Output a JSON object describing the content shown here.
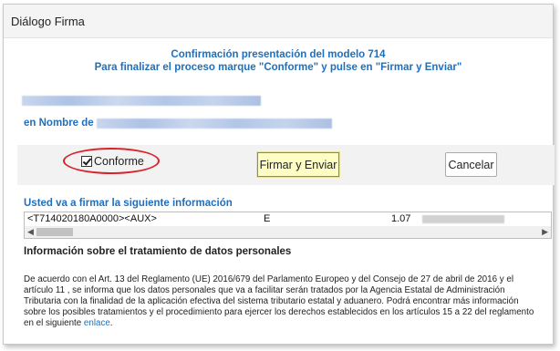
{
  "window": {
    "title": "Diálogo Firma"
  },
  "header": {
    "line1": "Confirmación presentación del modelo 714",
    "line2": "Para finalizar el proceso marque \"Conforme\" y pulse en \"Firmar y Enviar\""
  },
  "nombre": {
    "label": "en Nombre de"
  },
  "actions": {
    "conforme_label": "Conforme",
    "conforme_checked": true,
    "sign_button": "Firmar y Enviar",
    "cancel_button": "Cancelar"
  },
  "sign_info": {
    "heading": "Usted va a firmar la siguiente información",
    "row": {
      "code": "<T714020180A0000><AUX>",
      "flag": "E",
      "amount": "1.07"
    }
  },
  "privacy": {
    "heading": "Información sobre el tratamiento de datos personales",
    "text": "De acuerdo con el Art. 13 del Reglamento (UE) 2016/679 del Parlamento Europeo y del Consejo de 27 de abril de 2016 y el artículo 11 , se informa que los datos personales que va a facilitar serán tratados por la Agencia Estatal de Administración Tributaria con la finalidad de la aplicación efectiva del sistema tributario estatal y aduanero. Podrá encontrar más información sobre los posibles tratamientos y el procedimiento para ejercer los derechos establecidos en los artículos 15 a 22 del reglamento en el siguiente",
    "link": "enlace",
    "end": "."
  },
  "colors": {
    "accent": "#1f6fbd",
    "highlight_button": "#fefdc4",
    "annotation": "#d9232a"
  }
}
